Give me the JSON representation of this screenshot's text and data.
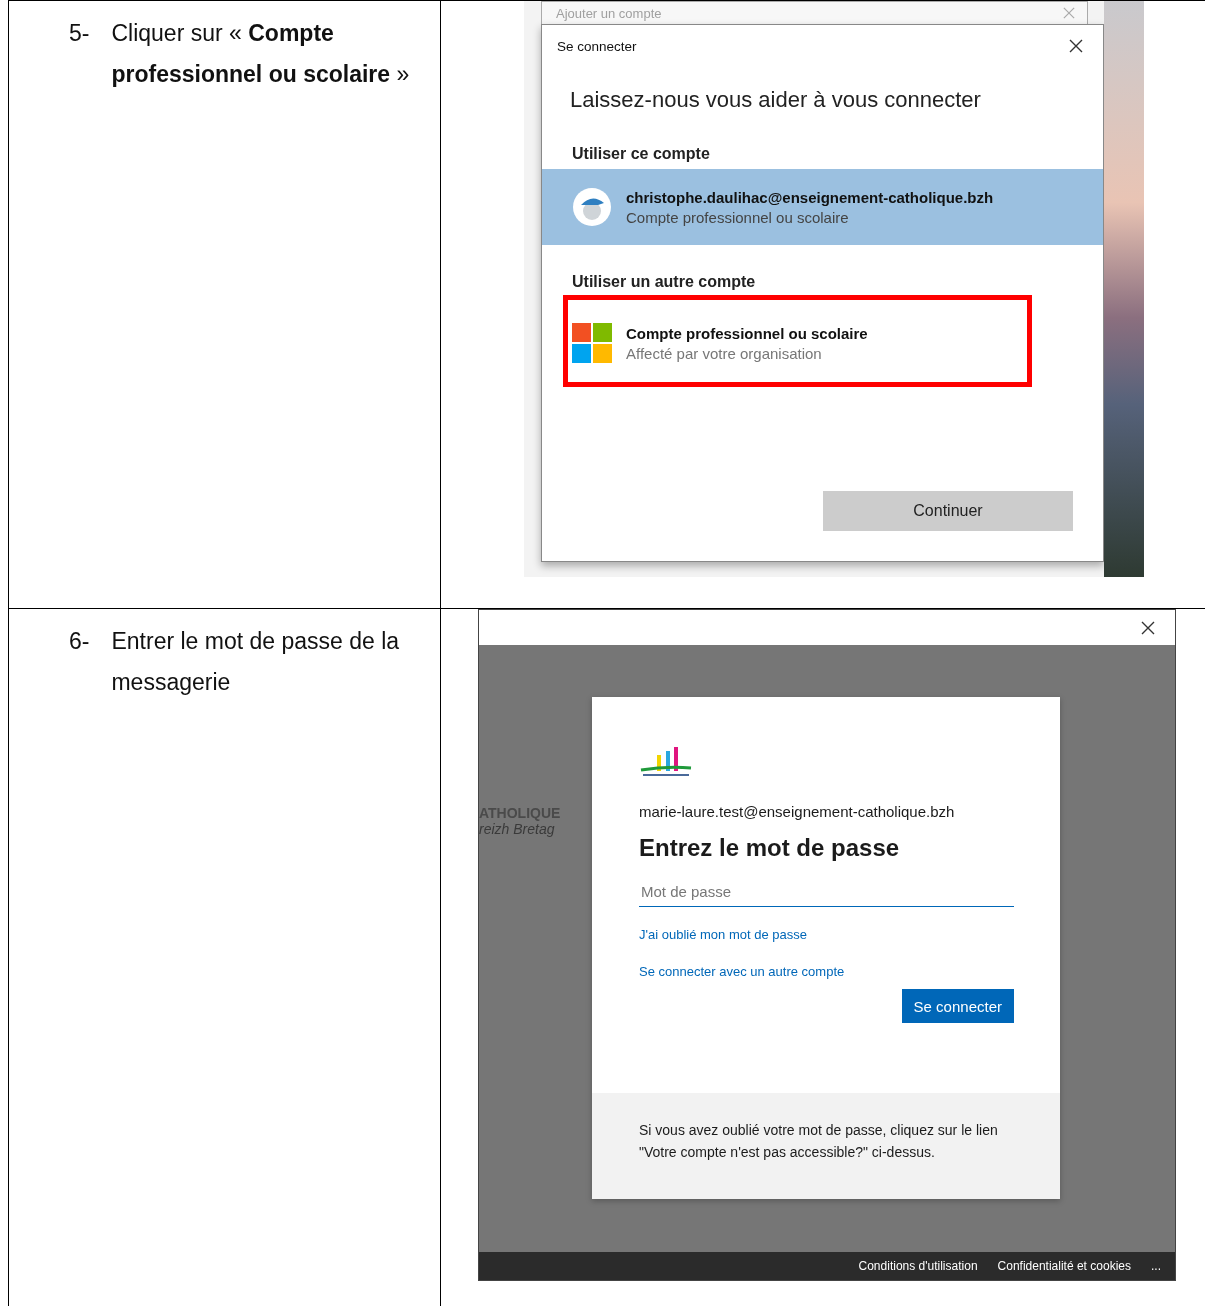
{
  "steps": [
    {
      "number": "5-",
      "instruction": "Cliquer sur « **Compte professionnel ou scolaire** »",
      "screen": {
        "kind": "account-picker",
        "back_window_title": "Ajouter un compte",
        "dialog_title": "Se connecter",
        "heading": "Laissez-nous vous aider à vous connecter",
        "current_section": "Utiliser ce compte",
        "current_account": {
          "email": "christophe.daulihac@enseignement-catholique.bzh",
          "type": "Compte professionnel ou scolaire",
          "selected": true
        },
        "other_section": "Utiliser un autre compte",
        "other_option": {
          "title": "Compte professionnel ou scolaire",
          "subtitle": "Affecté par votre organisation",
          "highlighted": true
        },
        "button": "Continuer"
      }
    },
    {
      "number": "6-",
      "instruction": "Entrer le mot de passe de la messagerie",
      "screen": {
        "kind": "password",
        "background_text": [
          "ATHOLIQUE",
          "reizh Bretag"
        ],
        "email": "marie-laure.test@enseignement-catholique.bzh",
        "heading": "Entrez le mot de passe",
        "password_placeholder": "Mot de passe",
        "links": [
          "J'ai oublié mon mot de passe",
          "Se connecter avec un autre compte"
        ],
        "button": "Se connecter",
        "note": "Si vous avez oublié votre mot de passe, cliquez sur le lien \"Votre compte n'est pas accessible?\" ci-dessus.",
        "footer_links": [
          "Conditions d'utilisation",
          "Confidentialité et cookies"
        ],
        "more": "..."
      }
    }
  ]
}
